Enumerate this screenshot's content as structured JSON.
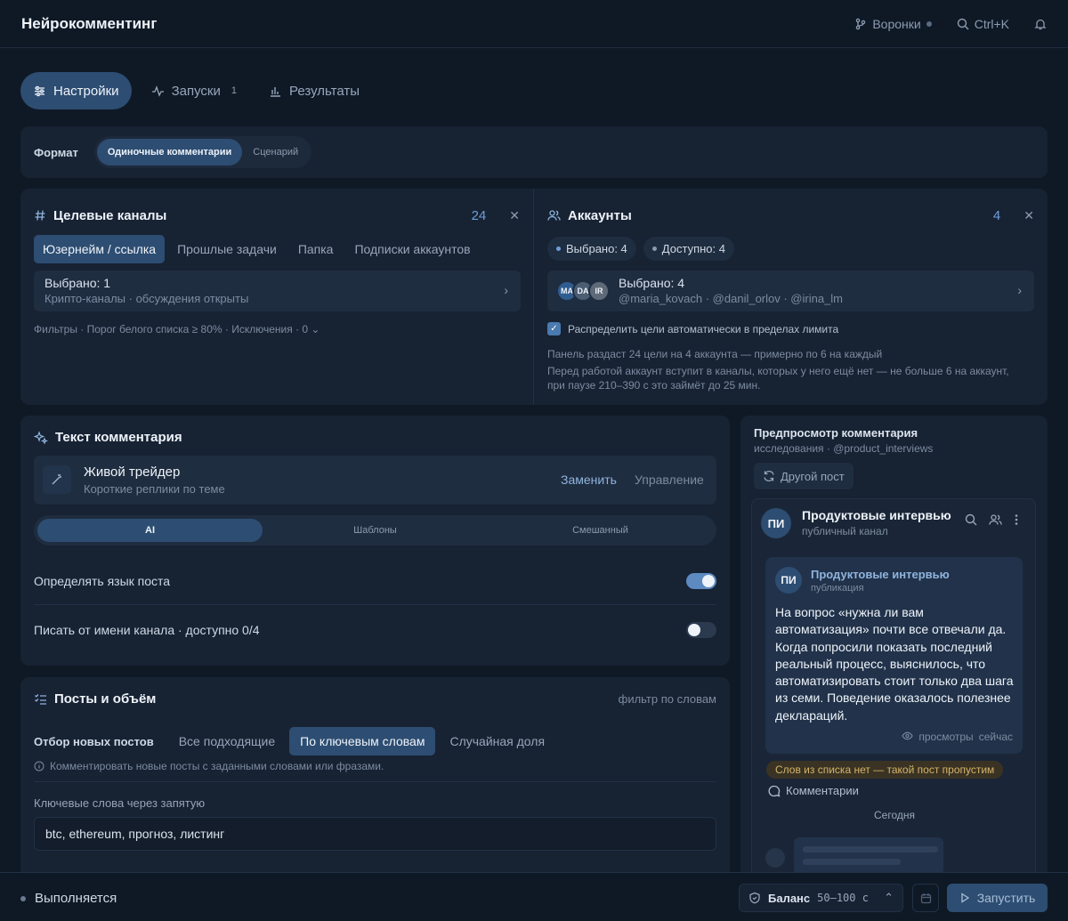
{
  "app": {
    "title": "Нейрокомментинг"
  },
  "topbar": {
    "funnels": "Воронки",
    "search_shortcut": "Ctrl+K"
  },
  "tabs": [
    {
      "label": "Настройки",
      "active": true
    },
    {
      "label": "Запуски",
      "count": "1"
    },
    {
      "label": "Результаты"
    }
  ],
  "format": {
    "label": "Формат",
    "options": [
      "Одиночные комментарии",
      "Сценарий"
    ],
    "selected": "Одиночные комментарии"
  },
  "channels": {
    "title": "Целевые каналы",
    "count": "24",
    "subtabs": [
      "Юзернейм / ссылка",
      "Прошлые задачи",
      "Папка",
      "Подписки аккаунтов"
    ],
    "selected_title": "Выбрано: 1",
    "selected_sub": "Крипто-каналы · обсуждения открыты",
    "filters": "Фильтры · Порог белого списка ≥ 80% · Исключения · 0 ⌄"
  },
  "accounts": {
    "title": "Аккаунты",
    "count": "4",
    "pill_selected": "Выбрано: 4",
    "pill_available": "Доступно: 4",
    "avatars": [
      "MA",
      "DA",
      "IR"
    ],
    "selected_title": "Выбрано: 4",
    "selected_sub": "@maria_kovach · @danil_orlov · @irina_lm",
    "auto_distribute": "Распределить цели автоматически в пределах лимита",
    "note1": "Панель раздаст 24 цели на 4 аккаунта — примерно по 6 на каждый",
    "note2": "Перед работой аккаунт вступит в каналы, которых у него ещё нет — не больше 6 на аккаунт,",
    "note3": "при паузе 210–390 с это займёт до 25 мин."
  },
  "comment_text": {
    "title": "Текст комментария",
    "persona_name": "Живой трейдер",
    "persona_desc": "Короткие реплики по теме",
    "replace": "Заменить",
    "manage": "Управление",
    "modes": [
      "AI",
      "Шаблоны",
      "Смешанный"
    ],
    "detect_lang": "Определять язык поста",
    "as_channel": "Писать от имени канала · доступно 0/4"
  },
  "posts": {
    "title": "Посты и объём",
    "right_hint": "фильтр по словам",
    "select_label": "Отбор новых постов",
    "options": [
      "Все подходящие",
      "По ключевым словам",
      "Случайная доля"
    ],
    "selected": "По ключевым словам",
    "info": "Комментировать новые посты с заданными словами или фразами.",
    "keywords_label": "Ключевые слова через запятую",
    "keywords_value": "btc, ethereum, прогноз, листинг"
  },
  "preview": {
    "title": "Предпросмотр комментария",
    "subtitle": "исследования · @product_interviews",
    "other_post": "Другой пост",
    "channel_name": "Продуктовые интервью",
    "channel_type": "публичный канал",
    "avatar": "ПИ",
    "post_author": "Продуктовые интервью",
    "post_kind": "публикация",
    "post_text": "На вопрос «нужна ли вам автоматизация» почти все отвечали да. Когда попросили показать последний реальный процесс, выяснилось, что автоматизировать стоит только два шага из семи. Поведение оказалось полезнее деклараций.",
    "views": "просмотры",
    "time": "сейчас",
    "warning": "Слов из списка нет — такой пост пропустим",
    "comments": "Комментарии",
    "today": "Сегодня"
  },
  "bottom": {
    "status": "Выполняется",
    "balance_label": "Баланс",
    "balance_value": "50–100 с",
    "run": "Запустить"
  },
  "colors": {
    "background": "#0f1926",
    "card": "#172233",
    "accent": "#2d4d72",
    "link": "#8fb4dd"
  }
}
